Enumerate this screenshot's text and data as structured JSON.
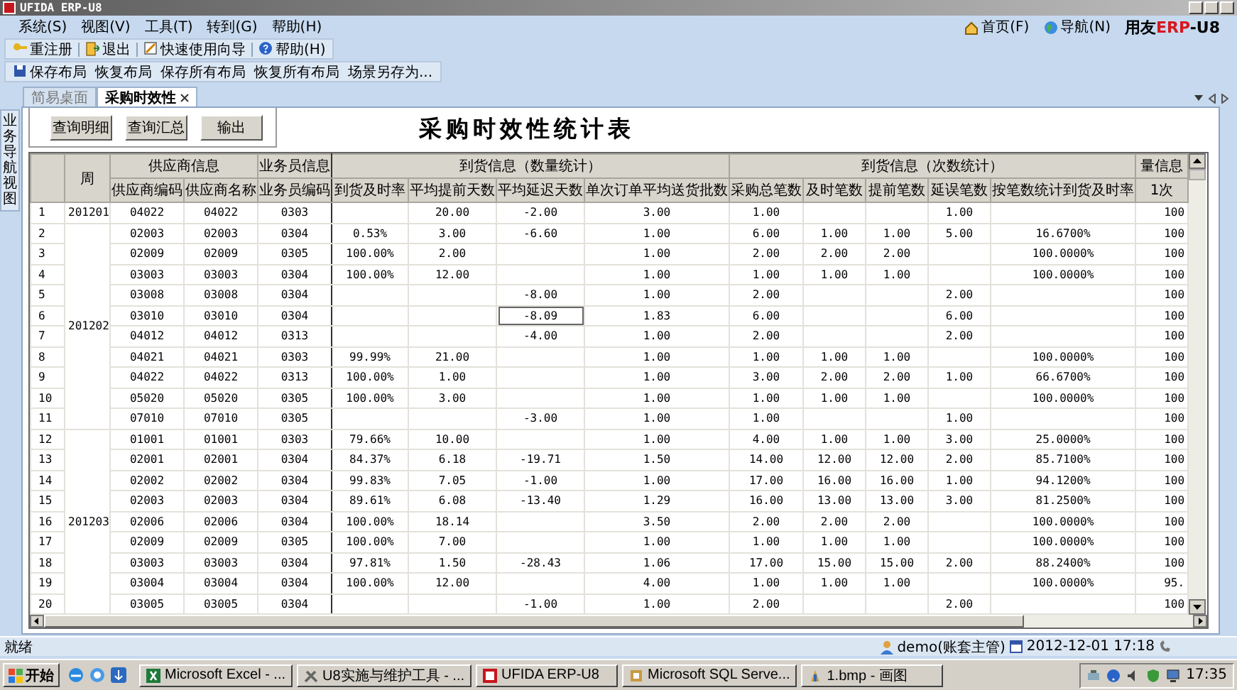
{
  "window": {
    "title": "UFIDA ERP-U8"
  },
  "menu": [
    "系统(S)",
    "视图(V)",
    "工具(T)",
    "转到(G)",
    "帮助(H)"
  ],
  "top_links": [
    {
      "label": "首页(F)",
      "kind": "home"
    },
    {
      "label": "导航(N)",
      "kind": "globe"
    }
  ],
  "logo": {
    "part_1": "用友",
    "part_2": "ERP",
    "part_3": "-U8"
  },
  "toolbar": [
    {
      "label": "重注册",
      "kind": "relogin"
    },
    {
      "label": "退出",
      "kind": "exit"
    },
    {
      "label": "快速使用向导",
      "kind": "wizard"
    },
    {
      "label": "帮助(H)",
      "kind": "help"
    }
  ],
  "layout_toolbar": [
    {
      "label": "保存布局",
      "kind": "save"
    },
    {
      "label": "恢复布局"
    },
    {
      "label": "保存所有布局"
    },
    {
      "label": "恢复所有布局"
    },
    {
      "label": "场景另存为..."
    }
  ],
  "tabs": [
    {
      "label": "简易桌面",
      "selected": false,
      "closable": false
    },
    {
      "label": "采购时效性",
      "selected": true,
      "closable": true
    }
  ],
  "side_panel": {
    "label": "业务导航视图"
  },
  "report": {
    "buttons": [
      "查询明细",
      "查询汇总",
      "输出"
    ],
    "title": "采购时效性统计表",
    "table": {
      "column_groups": [
        {
          "kind": "index"
        },
        {
          "kind": "single",
          "label": "周"
        },
        {
          "kind": "group",
          "label": "供应商信息",
          "columns": [
            {
              "label": "供应商编码"
            },
            {
              "label": "供应商名称"
            }
          ]
        },
        {
          "kind": "group",
          "label": "业务员信息",
          "columns": [
            {
              "label": "业务员编码"
            }
          ]
        },
        {
          "kind": "group",
          "label": "到货信息（数量统计）",
          "columns": [
            {
              "label": "到货及时率"
            },
            {
              "label": "平均提前天数"
            },
            {
              "label": "平均延迟天数"
            },
            {
              "label": "单次订单平均送货批数"
            }
          ]
        },
        {
          "kind": "group",
          "label": "到货信息（次数统计）",
          "columns": [
            {
              "label": "采购总笔数"
            },
            {
              "label": "及时笔数"
            },
            {
              "label": "提前笔数"
            },
            {
              "label": "延误笔数"
            },
            {
              "label": "按笔数统计到货及时率"
            }
          ]
        },
        {
          "kind": "group",
          "label": "量信息",
          "columns": [
            {
              "label": "1次"
            }
          ]
        }
      ],
      "periods": [
        {
          "label": "201201",
          "rows": [
            {
              "no": "1",
              "cells": [
                "04022",
                "04022",
                "0303",
                "",
                "20.00",
                "-2.00",
                "3.00",
                "1.00",
                "",
                "",
                "1.00",
                "",
                "100"
              ]
            }
          ]
        },
        {
          "label": "201202",
          "rows": [
            {
              "no": "2",
              "cells": [
                "02003",
                "02003",
                "0304",
                "0.53%",
                "3.00",
                "-6.60",
                "1.00",
                "6.00",
                "1.00",
                "1.00",
                "5.00",
                "16.6700%",
                "100"
              ]
            },
            {
              "no": "3",
              "cells": [
                "02009",
                "02009",
                "0305",
                "100.00%",
                "2.00",
                "",
                "1.00",
                "2.00",
                "2.00",
                "2.00",
                "",
                "100.0000%",
                "100"
              ]
            },
            {
              "no": "4",
              "cells": [
                "03003",
                "03003",
                "0304",
                "100.00%",
                "12.00",
                "",
                "1.00",
                "1.00",
                "1.00",
                "1.00",
                "",
                "100.0000%",
                "100"
              ]
            },
            {
              "no": "5",
              "cells": [
                "03008",
                "03008",
                "0304",
                "",
                "",
                "-8.00",
                "1.00",
                "2.00",
                "",
                "",
                "2.00",
                "",
                "100"
              ]
            },
            {
              "no": "6",
              "cells": [
                "03010",
                "03010",
                "0304",
                "",
                "",
                {
                  "value": "-8.09",
                  "selected": true
                },
                "1.83",
                "6.00",
                "",
                "",
                "6.00",
                "",
                "100"
              ]
            },
            {
              "no": "7",
              "cells": [
                "04012",
                "04012",
                "0313",
                "",
                "",
                "-4.00",
                "1.00",
                "2.00",
                "",
                "",
                "2.00",
                "",
                "100"
              ]
            },
            {
              "no": "8",
              "cells": [
                "04021",
                "04021",
                "0303",
                "99.99%",
                "21.00",
                "",
                "1.00",
                "1.00",
                "1.00",
                "1.00",
                "",
                "100.0000%",
                "100"
              ]
            },
            {
              "no": "9",
              "cells": [
                "04022",
                "04022",
                "0313",
                "100.00%",
                "1.00",
                "",
                "1.00",
                "3.00",
                "2.00",
                "2.00",
                "1.00",
                "66.6700%",
                "100"
              ]
            },
            {
              "no": "10",
              "cells": [
                "05020",
                "05020",
                "0305",
                "100.00%",
                "3.00",
                "",
                "1.00",
                "1.00",
                "1.00",
                "1.00",
                "",
                "100.0000%",
                "100"
              ]
            },
            {
              "no": "11",
              "cells": [
                "07010",
                "07010",
                "0305",
                "",
                "",
                "-3.00",
                "1.00",
                "1.00",
                "",
                "",
                "1.00",
                "",
                "100"
              ]
            }
          ]
        },
        {
          "label": "201203",
          "rows": [
            {
              "no": "12",
              "cells": [
                "01001",
                "01001",
                "0303",
                "79.66%",
                "10.00",
                "",
                "1.00",
                "4.00",
                "1.00",
                "1.00",
                "3.00",
                "25.0000%",
                "100"
              ]
            },
            {
              "no": "13",
              "cells": [
                "02001",
                "02001",
                "0304",
                "84.37%",
                "6.18",
                "-19.71",
                "1.50",
                "14.00",
                "12.00",
                "12.00",
                "2.00",
                "85.7100%",
                "100"
              ]
            },
            {
              "no": "14",
              "cells": [
                "02002",
                "02002",
                "0304",
                "99.83%",
                "7.05",
                "-1.00",
                "1.00",
                "17.00",
                "16.00",
                "16.00",
                "1.00",
                "94.1200%",
                "100"
              ]
            },
            {
              "no": "15",
              "cells": [
                "02003",
                "02003",
                "0304",
                "89.61%",
                "6.08",
                "-13.40",
                "1.29",
                "16.00",
                "13.00",
                "13.00",
                "3.00",
                "81.2500%",
                "100"
              ]
            },
            {
              "no": "16",
              "cells": [
                "02006",
                "02006",
                "0304",
                "100.00%",
                "18.14",
                "",
                "3.50",
                "2.00",
                "2.00",
                "2.00",
                "",
                "100.0000%",
                "100"
              ]
            },
            {
              "no": "17",
              "cells": [
                "02009",
                "02009",
                "0305",
                "100.00%",
                "7.00",
                "",
                "1.00",
                "1.00",
                "1.00",
                "1.00",
                "",
                "100.0000%",
                "100"
              ]
            },
            {
              "no": "18",
              "cells": [
                "03003",
                "03003",
                "0304",
                "97.81%",
                "1.50",
                "-28.43",
                "1.06",
                "17.00",
                "15.00",
                "15.00",
                "2.00",
                "88.2400%",
                "100"
              ]
            },
            {
              "no": "19",
              "cells": [
                "03004",
                "03004",
                "0304",
                "100.00%",
                "12.00",
                "",
                "4.00",
                "1.00",
                "1.00",
                "1.00",
                "",
                "100.0000%",
                "95."
              ]
            },
            {
              "no": "20",
              "cells": [
                "03005",
                "03005",
                "0304",
                "",
                "",
                "-1.00",
                "1.00",
                "2.00",
                "",
                "",
                "2.00",
                "",
                "100"
              ]
            }
          ]
        }
      ]
    }
  },
  "status": {
    "text": "就绪",
    "user": "demo(账套主管)",
    "datetime": "2012-12-01 17:18"
  },
  "taskbar": {
    "start": "开始",
    "tasks": [
      {
        "label": "Microsoft Excel - ...",
        "kind": "excel",
        "selected": false
      },
      {
        "label": "U8实施与维护工具 - ...",
        "kind": "tools",
        "selected": false
      },
      {
        "label": "UFIDA ERP-U8",
        "kind": "u8",
        "selected": false
      },
      {
        "label": "Microsoft SQL Serve...",
        "kind": "sql",
        "selected": false
      },
      {
        "label": "1.bmp - 画图",
        "kind": "paint",
        "selected": false
      }
    ],
    "clock": "17:35"
  }
}
